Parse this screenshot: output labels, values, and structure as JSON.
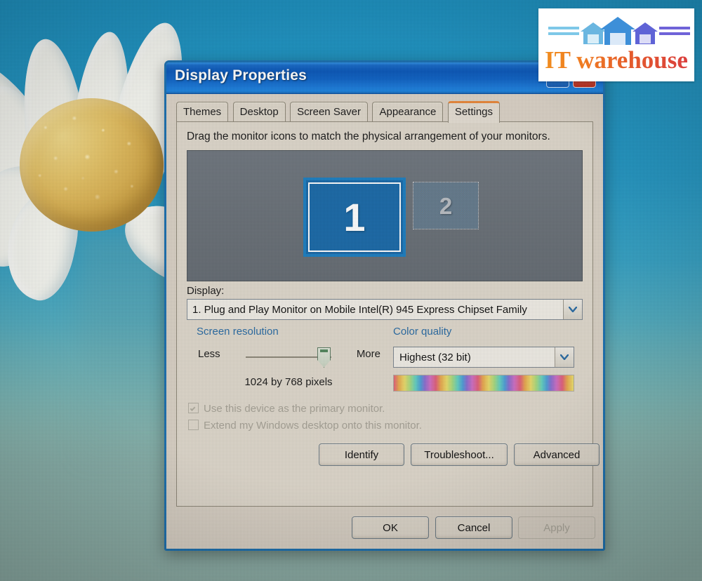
{
  "desktop": {
    "wallpaper_name": "daisy-flower-wallpaper",
    "background_colors": [
      "#1b8fbe",
      "#3aa3bf",
      "#8fb2a8"
    ]
  },
  "watermark": {
    "name": "it-warehouse-logo",
    "text": "IT warehouse",
    "text_gradient": [
      "#f0901f",
      "#d93b3f"
    ],
    "house_colors": [
      "#6ab6e0",
      "#3d8fd8",
      "#5f63d6"
    ]
  },
  "dialog": {
    "title": "Display Properties",
    "titlebar_color": "#0a57b8",
    "border_color": "#1b6fae",
    "buttons": {
      "help_label": "?",
      "close_label": "✕"
    },
    "tabs": [
      {
        "label": "Themes",
        "active": false
      },
      {
        "label": "Desktop",
        "active": false
      },
      {
        "label": "Screen Saver",
        "active": false
      },
      {
        "label": "Appearance",
        "active": false
      },
      {
        "label": "Settings",
        "active": true
      }
    ],
    "active_tab_accent": "#e8873a",
    "settings": {
      "help_text": "Drag the monitor icons to match the physical arrangement of your monitors.",
      "monitors": [
        {
          "number": "1",
          "selected": true
        },
        {
          "number": "2",
          "selected": false
        }
      ],
      "display_label": "Display:",
      "display_value": "1. Plug and Play Monitor on Mobile Intel(R) 945 Express Chipset Family",
      "screen_resolution": {
        "group_title": "Screen resolution",
        "less_label": "Less",
        "more_label": "More",
        "value_text": "1024 by 768 pixels",
        "slider_percent": 82
      },
      "color_quality": {
        "group_title": "Color quality",
        "value": "Highest (32 bit)"
      },
      "checkboxes": [
        {
          "label": "Use this device as the primary monitor.",
          "checked": true,
          "enabled": false
        },
        {
          "label": "Extend my Windows desktop onto this monitor.",
          "checked": false,
          "enabled": false
        }
      ],
      "action_buttons": [
        {
          "label": "Identify",
          "enabled": true
        },
        {
          "label": "Troubleshoot...",
          "enabled": true
        },
        {
          "label": "Advanced",
          "enabled": true
        }
      ]
    },
    "footer_buttons": [
      {
        "label": "OK",
        "enabled": true
      },
      {
        "label": "Cancel",
        "enabled": true
      },
      {
        "label": "Apply",
        "enabled": false
      }
    ]
  }
}
